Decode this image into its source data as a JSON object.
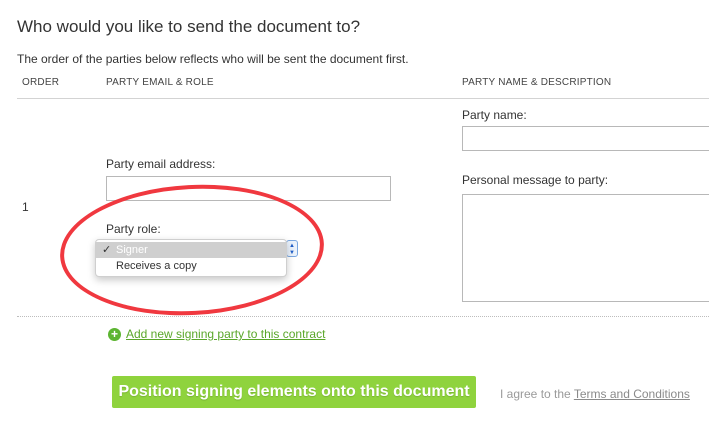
{
  "heading": "Who would you like to send the document to?",
  "subtext": "The order of the parties below reflects who will be sent the document first.",
  "columns": {
    "order": "ORDER",
    "email_role": "PARTY EMAIL & ROLE",
    "name_desc": "PARTY NAME & DESCRIPTION"
  },
  "party": {
    "order": "1",
    "email_label": "Party email address:",
    "email_value": "",
    "role_label": "Party role:",
    "role_options": [
      {
        "label": "Signer",
        "selected": true,
        "check": "✓"
      },
      {
        "label": "Receives a copy",
        "selected": false
      }
    ],
    "name_label": "Party name:",
    "name_value": "",
    "message_label": "Personal message to party:"
  },
  "add_party_link": "Add new signing party to this contract",
  "primary_button": "Position signing elements onto this document",
  "agree_prefix": "I agree to the",
  "terms_link": "Terms and Conditions",
  "colors": {
    "accent_green": "#8fd33d",
    "link_green": "#5aa72a",
    "annotation_red": "#f0383f"
  }
}
